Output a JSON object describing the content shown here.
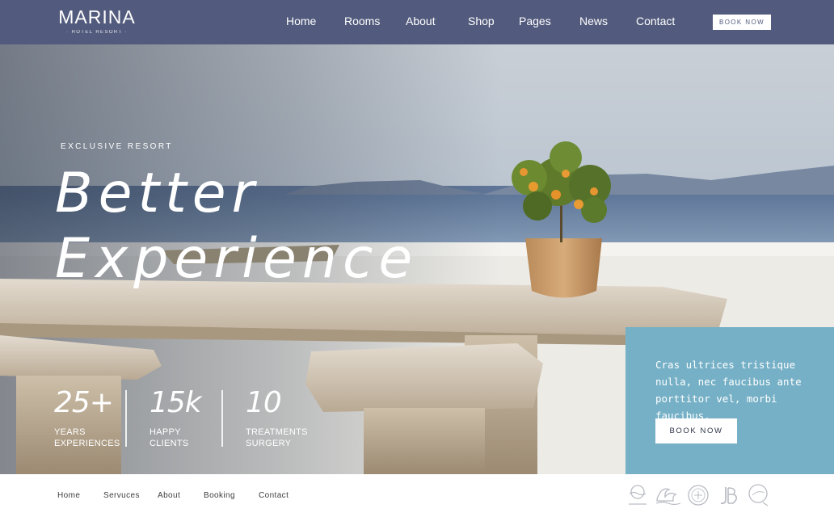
{
  "brand": {
    "name": "MARINA",
    "tagline": "· HOTEL RESORT ·"
  },
  "nav": {
    "items": [
      {
        "label": "Home"
      },
      {
        "label": "Rooms"
      },
      {
        "label": "About"
      },
      {
        "label": "Shop"
      },
      {
        "label": "Pages"
      },
      {
        "label": "News"
      },
      {
        "label": "Contact"
      }
    ],
    "cta": "BOOK NOW"
  },
  "hero": {
    "eyebrow": "EXCLUSIVE RESORT",
    "headline_line1": "Better",
    "headline_line2": "Experience"
  },
  "stats": [
    {
      "value": "25+",
      "label_line1": "YEARS",
      "label_line2": "EXPERIENCES"
    },
    {
      "value": "15k",
      "label_line1": "HAPPY",
      "label_line2": "CLIENTS"
    },
    {
      "value": "10",
      "label_line1": "TREATMENTS",
      "label_line2": "SURGERY"
    }
  ],
  "promo": {
    "text": "Cras ultrices tristique nulla, nec faucibus ante porttitor vel, morbi faucibus.",
    "cta": "BOOK NOW"
  },
  "footer": {
    "links": [
      {
        "label": "Home"
      },
      {
        "label": "Servuces"
      },
      {
        "label": "About"
      },
      {
        "label": "Booking"
      },
      {
        "label": "Contact"
      }
    ],
    "partner_logos": [
      "sun-sea-logo-icon",
      "wave-logo-icon",
      "seal-logo-icon",
      "jb-monogram-logo-icon",
      "sun-circle-logo-icon"
    ]
  },
  "colors": {
    "header_bg": "#525b7d",
    "promo_bg": "#75b0c6",
    "text_light": "#ffffff",
    "footer_text": "#3e3e3e"
  }
}
